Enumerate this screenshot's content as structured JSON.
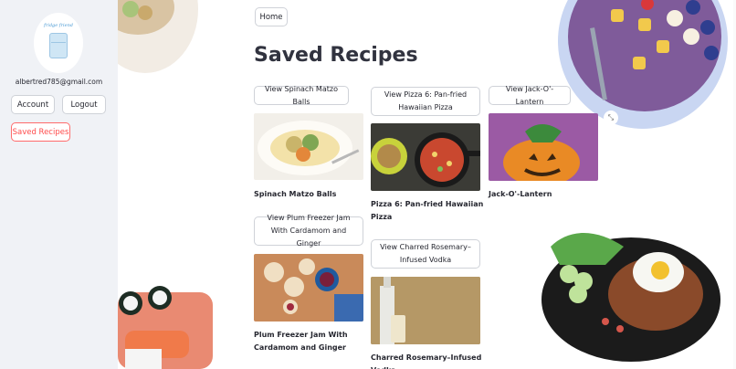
{
  "sidebar": {
    "logo_text": "fridge friend",
    "email": "albertred785@gmail.com",
    "account_label": "Account",
    "logout_label": "Logout",
    "saved_label": "Saved Recipes"
  },
  "main": {
    "home_label": "Home",
    "title": "Saved Recipes",
    "recipes": [
      {
        "button": "View Spinach Matzo Balls",
        "name": "Spinach Matzo Balls"
      },
      {
        "button": "View Pizza 6: Pan-fried Hawaiian Pizza",
        "name": "Pizza 6: Pan-fried Hawaiian Pizza"
      },
      {
        "button": "View Jack-O'-Lantern",
        "name": "Jack-O'-Lantern"
      },
      {
        "button": "View Plum Freezer Jam With Cardamom and Ginger",
        "name": "Plum Freezer Jam With Cardamom and Ginger"
      },
      {
        "button": "View Charred Rosemary–Infused Vodka",
        "name": "Charred Rosemary–Infused Vodka"
      }
    ]
  },
  "icons": {
    "expand": "expand-icon"
  },
  "colors": {
    "accent": "#ff4b4b",
    "sidebar_bg": "#f0f2f6"
  }
}
